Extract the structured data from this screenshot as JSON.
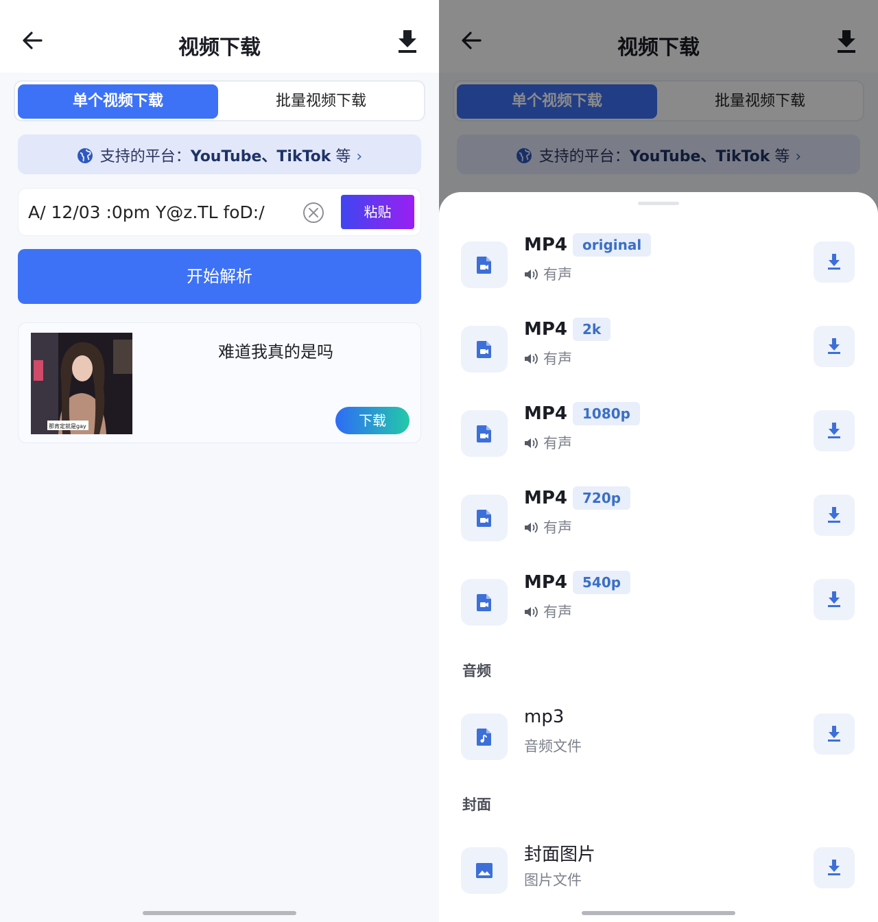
{
  "colors": {
    "accent": "#3d72f7",
    "paste_gradient": [
      "#3f46f0",
      "#9b1ff2"
    ],
    "download_gradient": [
      "#2e6cf6",
      "#23c9a9"
    ]
  },
  "header": {
    "title": "视频下载"
  },
  "tabs": {
    "single": "单个视频下载",
    "batch": "批量视频下载"
  },
  "platform": {
    "label": "支持的平台：",
    "sites": "YouTube、TikTok",
    "suffix": "等",
    "chevron": "›"
  },
  "input": {
    "value": "A/ 12/03 :0pm Y@z.TL foD:/",
    "paste_label": "粘贴"
  },
  "parse_button": "开始解析",
  "result": {
    "title": "难道我真的是吗",
    "download_label": "下载",
    "thumb_caption": "那肯定就是gay"
  },
  "sheet": {
    "video_items": [
      {
        "format": "MP4",
        "quality": "original",
        "audio": "有声"
      },
      {
        "format": "MP4",
        "quality": "2k",
        "audio": "有声"
      },
      {
        "format": "MP4",
        "quality": "1080p",
        "audio": "有声"
      },
      {
        "format": "MP4",
        "quality": "720p",
        "audio": "有声"
      },
      {
        "format": "MP4",
        "quality": "540p",
        "audio": "有声"
      }
    ],
    "audio_section": "音频",
    "audio_item": {
      "name": "mp3",
      "desc": "音频文件"
    },
    "cover_section": "封面",
    "cover_item": {
      "name": "封面图片",
      "desc": "图片文件"
    }
  }
}
